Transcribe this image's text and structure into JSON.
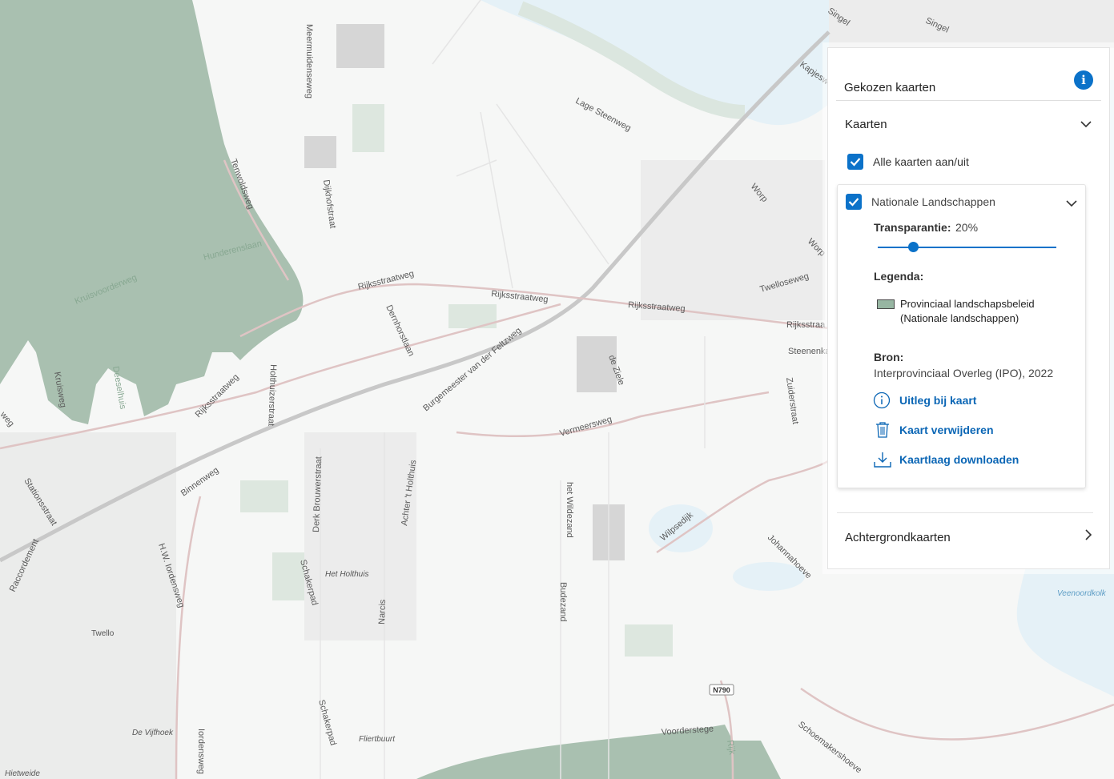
{
  "map": {
    "streets": [
      "Meermuidenseweg",
      "Lage Steenweg",
      "Singel",
      "Singel",
      "Kapjesw",
      "Tenwoldsweg",
      "Dijkhofstraat",
      "Hunderenslaan",
      "Kruisvoorderweg",
      "Rijksstraatweg",
      "Rijksstraatweg",
      "Rijksstraatweg",
      "Rijksstraatweg",
      "Rijksstraa",
      "Dernhorstlaan",
      "Burgemeester van der Feltzweg",
      "Worp",
      "Worp",
      "Twelloseweg",
      "Steenenka",
      "Zuiderstraat",
      "de Ziele",
      "Vermeersweg",
      "Holthuizerstraat",
      "Binnenweg",
      "Stationsstraat",
      "Raccordement",
      "H.W. Iordensweg",
      "Derk Brouwerstraat",
      "Achter 't Holthuis",
      "Schakerpad",
      "Schakerpad",
      "Narcis",
      "het Wildezand",
      "Budezand",
      "Wilpsedijk",
      "Johannahoeve",
      "Schoemakershoeve",
      "Voorderstege",
      "Iordensweg",
      "Kruisweg",
      "Deeselhuis",
      "weg",
      "Rijk"
    ],
    "places": [
      "Het Holthuis",
      "Twello",
      "De Vijfhoek",
      "Fliertbuurt",
      "Hietweide"
    ],
    "water": [
      "Veenoordkolk"
    ],
    "road_badge": "N790",
    "colors": {
      "landscape": "#a9c0b0",
      "water": "#e5f1f7",
      "background": "#f6f7f6"
    }
  },
  "panel": {
    "title": "Gekozen kaarten",
    "kaarten_label": "Kaarten",
    "toggle_all_label": "Alle kaarten aan/uit",
    "toggle_all_checked": true,
    "layer": {
      "name": "Nationale Landschappen",
      "checked": true,
      "transparency_label": "Transparantie:",
      "transparency_value": "20%",
      "transparency_fraction": 0.2,
      "legend_label": "Legenda:",
      "legend_item_line1": "Provinciaal landschapsbeleid",
      "legend_item_line2": "(Nationale landschappen)",
      "legend_color": "#97b6a2",
      "source_label": "Bron:",
      "source_value": "Interprovinciaal Overleg (IPO), 2022",
      "action_explain": "Uitleg bij kaart",
      "action_delete": "Kaart verwijderen",
      "action_download": "Kaartlaag downloaden"
    },
    "background_maps_label": "Achtergrondkaarten",
    "accent": "#0b72c9"
  }
}
